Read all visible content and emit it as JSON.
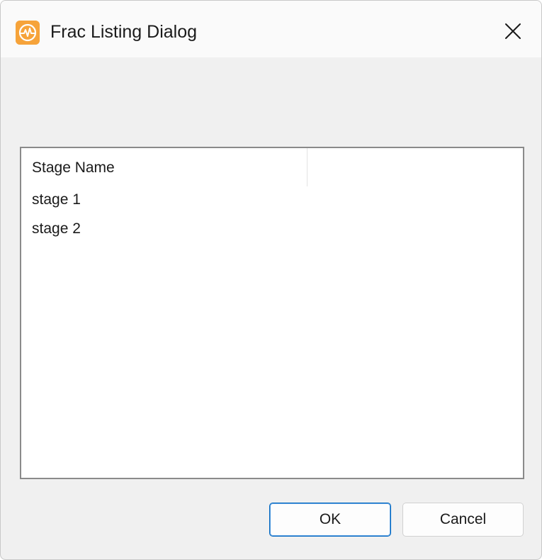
{
  "window": {
    "title": "Frac Listing Dialog",
    "app_icon": "app-logo-icon",
    "close_icon": "close-icon"
  },
  "list": {
    "columns": [
      "Stage Name",
      ""
    ],
    "rows": [
      "stage 1",
      "stage 2"
    ]
  },
  "buttons": {
    "ok_label": "OK",
    "cancel_label": "Cancel"
  },
  "colors": {
    "app_icon": "#f6a33a",
    "ok_border": "#0067c0",
    "dialog_background": "#f0f0f0"
  }
}
